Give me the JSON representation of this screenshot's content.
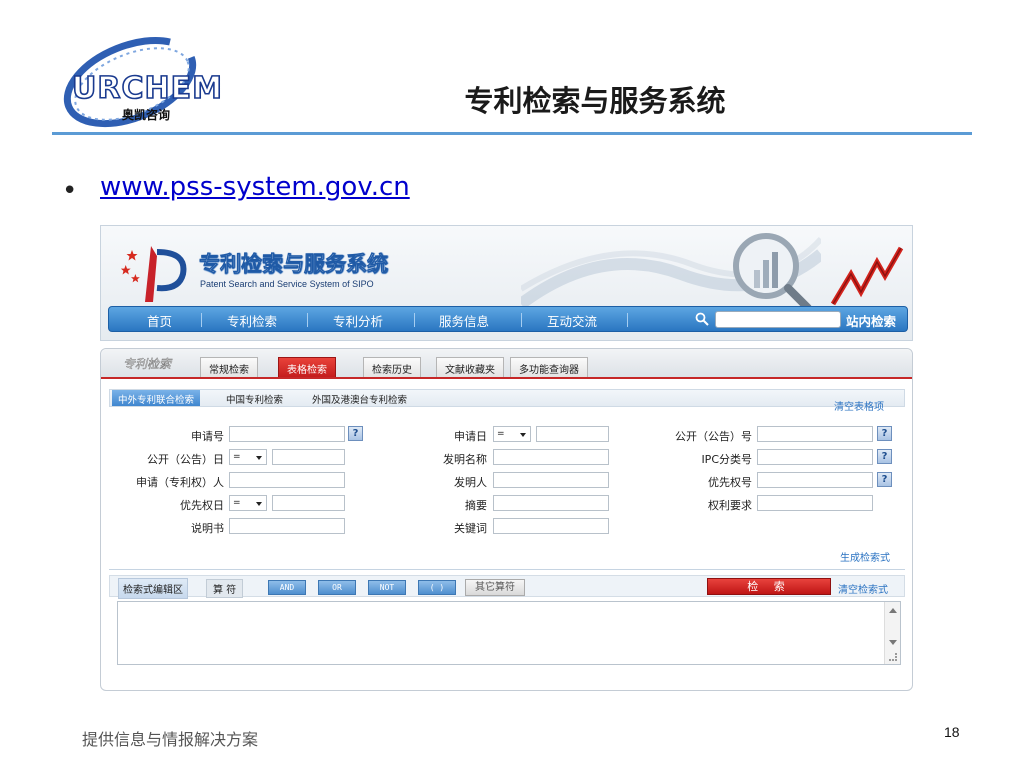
{
  "slide": {
    "logo_text": "URCHEM",
    "logo_subtitle": "奥凯咨询",
    "title": "专利检索与服务系统",
    "bullet": "•",
    "url": "www.pss-system.gov.cn",
    "footer": "提供信息与情报解决方案",
    "page_number": "18",
    "rule_color": "#5b9bd5"
  },
  "site": {
    "name_zh": "专利检索与服务系统",
    "name_en": "Patent Search and Service System of SIPO",
    "nav": [
      "首页",
      "专利检索",
      "专利分析",
      "服务信息",
      "互动交流"
    ],
    "search_placeholder": "",
    "site_search_label": "站内检索"
  },
  "panel": {
    "title": "专利检索",
    "tabs": [
      "常规检索",
      "表格检索",
      "检索历史",
      "文献收藏夹",
      "多功能查询器"
    ],
    "active_tab": "表格检索",
    "subtabs": [
      "中外专利联合检索",
      "中国专利检索",
      "外国及港澳台专利检索"
    ],
    "active_subtab": "中外专利联合检索",
    "clear_fields": "清空表格项",
    "fields": {
      "app_no": "申请号",
      "app_date": "申请日",
      "pub_no": "公开（公告）号",
      "pub_date": "公开（公告）日",
      "invention_name": "发明名称",
      "ipc": "IPC分类号",
      "applicant": "申请（专利权）人",
      "inventor": "发明人",
      "priority_no": "优先权号",
      "priority_date": "优先权日",
      "abstract": "摘要",
      "claims": "权利要求",
      "description": "说明书",
      "keywords": "关键词"
    },
    "operator_eq": "=",
    "help_glyph": "?",
    "generate_expr": "生成检索式",
    "editor_label": "检索式编辑区",
    "operators_label": "算 符",
    "operators": [
      "AND",
      "OR",
      "NOT",
      "( )"
    ],
    "other_operators": "其它算符",
    "search_button": "检 索",
    "clear_expr": "清空检索式",
    "accent_red": "#c62828",
    "link_blue": "#2b73c2"
  }
}
